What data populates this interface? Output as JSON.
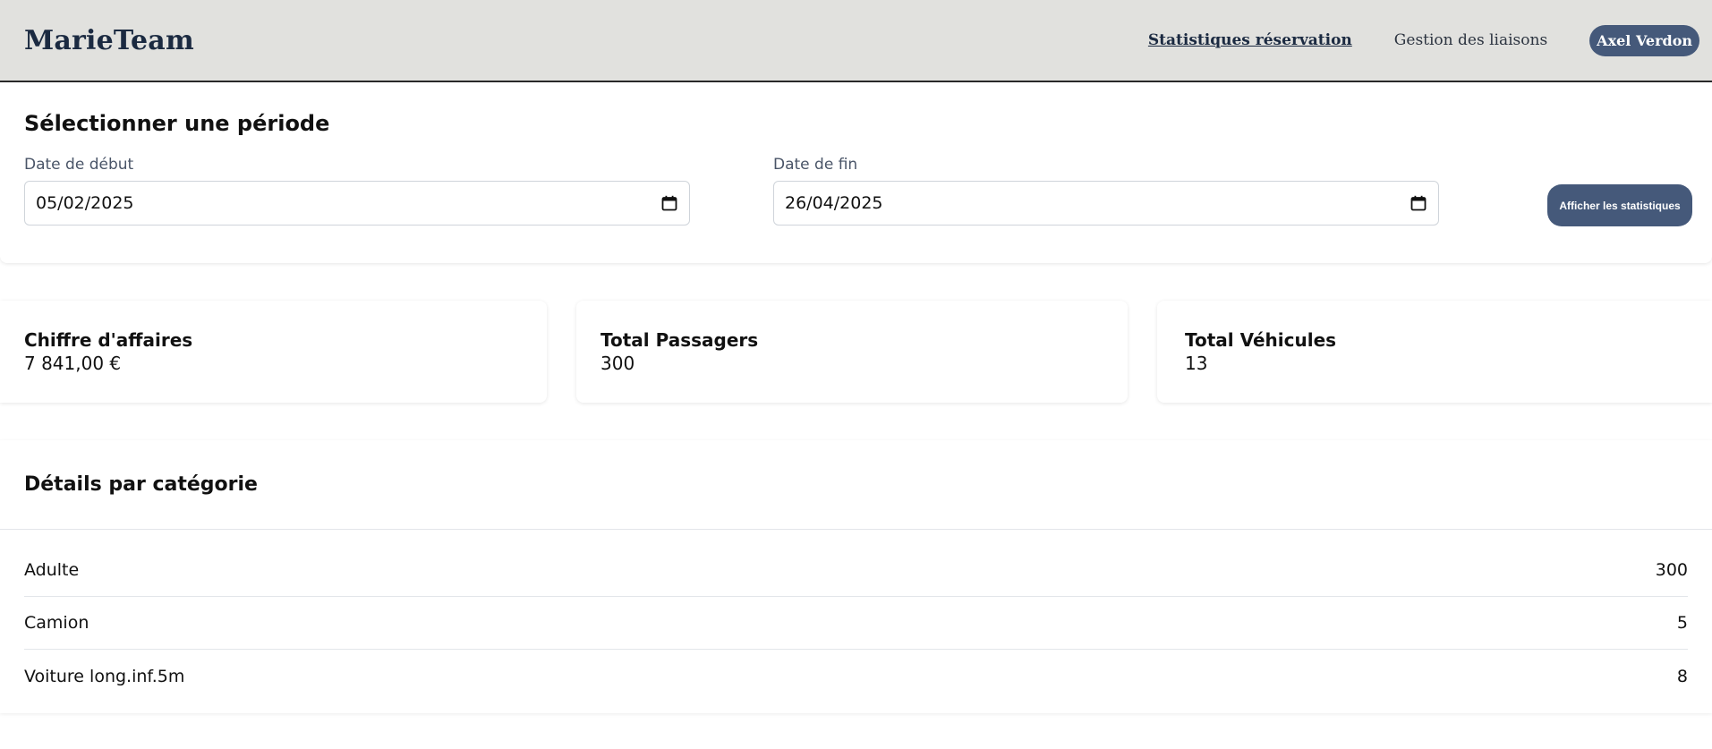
{
  "header": {
    "brand": "MarieTeam",
    "nav": [
      {
        "label": "Statistiques réservation",
        "active": true
      },
      {
        "label": "Gestion des liaisons",
        "active": false
      }
    ],
    "user": "Axel Verdon"
  },
  "period": {
    "title": "Sélectionner une période",
    "start_label": "Date de début",
    "start_value": "05/02/2025",
    "end_label": "Date de fin",
    "end_value": "26/04/2025",
    "submit_label": "Afficher les statistiques"
  },
  "stats": [
    {
      "label": "Chiffre d'affaires",
      "value": "7 841,00 €"
    },
    {
      "label": "Total Passagers",
      "value": "300"
    },
    {
      "label": "Total Véhicules",
      "value": "13"
    }
  ],
  "details": {
    "title": "Détails par catégorie",
    "rows": [
      {
        "category": "Adulte",
        "count": "300"
      },
      {
        "category": "Camion",
        "count": "5"
      },
      {
        "category": "Voiture long.inf.5m",
        "count": "8"
      }
    ]
  },
  "colors": {
    "header_bg": "#e1e1de",
    "accent": "#45597a",
    "brand": "#1b2a41"
  },
  "icons": {
    "date_picker": "calendar-icon"
  }
}
